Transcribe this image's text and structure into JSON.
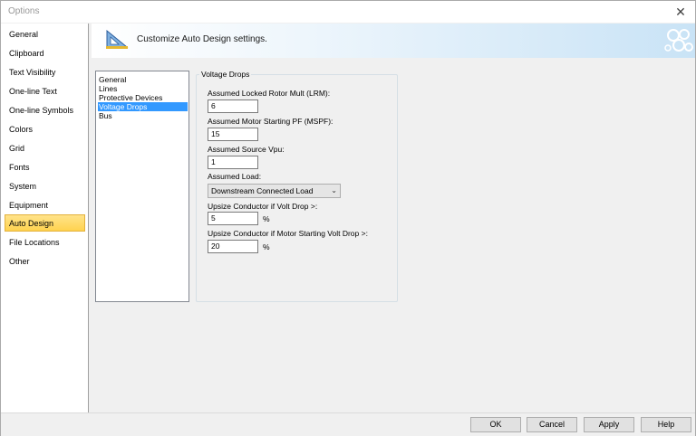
{
  "window": {
    "title": "Options",
    "close_glyph": "✕"
  },
  "nav": {
    "items": [
      {
        "label": "General"
      },
      {
        "label": "Clipboard"
      },
      {
        "label": "Text Visibility"
      },
      {
        "label": "One-line Text"
      },
      {
        "label": "One-line Symbols"
      },
      {
        "label": "Colors"
      },
      {
        "label": "Grid"
      },
      {
        "label": "Fonts"
      },
      {
        "label": "System"
      },
      {
        "label": "Equipment"
      },
      {
        "label": "Auto Design"
      },
      {
        "label": "File Locations"
      },
      {
        "label": "Other"
      }
    ],
    "active": "Auto Design",
    "active_color": "#ffd34f"
  },
  "banner": {
    "text": "Customize Auto Design settings.",
    "icon": "drafting-triangle-icon"
  },
  "tree": {
    "items": [
      {
        "label": "General"
      },
      {
        "label": "Lines"
      },
      {
        "label": "Protective Devices"
      },
      {
        "label": "Voltage Drops"
      },
      {
        "label": "Bus"
      }
    ],
    "selected": "Voltage Drops",
    "selected_color": "#3399ff"
  },
  "voltage_drops": {
    "group_title": "Voltage Drops",
    "lrm_label": "Assumed Locked Rotor Mult (LRM):",
    "lrm_value": "6",
    "mspf_label": "Assumed Motor Starting PF (MSPF):",
    "mspf_value": "15",
    "vpu_label": "Assumed Source Vpu:",
    "vpu_value": "1",
    "load_label": "Assumed Load:",
    "load_value": "Downstream Connected Load",
    "upsize_label": "Upsize Conductor if Volt Drop >:",
    "upsize_value": "5",
    "upsize_unit": "%",
    "motor_upsize_label": "Upsize Conductor if Motor Starting Volt Drop >:",
    "motor_upsize_value": "20",
    "motor_upsize_unit": "%"
  },
  "footer": {
    "ok": "OK",
    "cancel": "Cancel",
    "apply": "Apply",
    "help": "Help"
  }
}
